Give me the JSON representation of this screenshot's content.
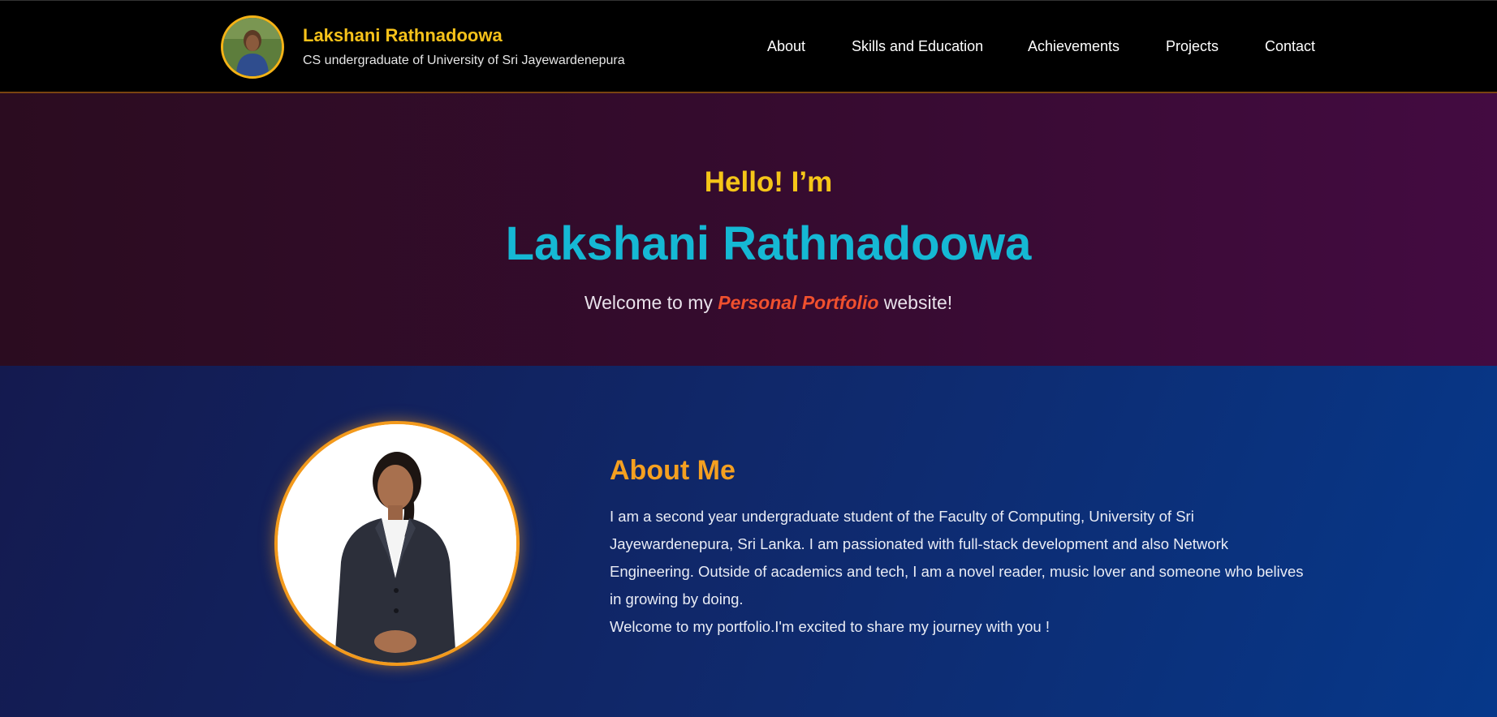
{
  "header": {
    "brand_name": "Lakshani Rathnadoowa",
    "brand_tagline": "CS undergraduate of University of Sri Jayewardenepura",
    "avatar_icon": "profile-photo",
    "nav": [
      {
        "label": "About"
      },
      {
        "label": "Skills and Education"
      },
      {
        "label": "Achievements"
      },
      {
        "label": "Projects"
      },
      {
        "label": "Contact"
      }
    ]
  },
  "hero": {
    "greeting": "Hello! I’m",
    "name": "Lakshani Rathnadoowa",
    "welcome_before": "Welcome to my",
    "welcome_highlight": "Personal Portfolio",
    "welcome_after": "website!"
  },
  "about": {
    "title": "About Me",
    "paragraph": "I am a second year undergraduate student of the Faculty of Computing, University of Sri Jayewardenepura, Sri Lanka. I am passionated with full-stack development and also Network Engineering. Outside of academics and tech, I am a novel reader, music lover and someone who belives in growing by doing.",
    "closing": "Welcome to my portfolio.I'm excited to share my journey with you !"
  },
  "colors": {
    "brand_accent": "#f7c21a",
    "hero_name": "#15b8d4",
    "highlight": "#f0502e",
    "about_title": "#f5a020"
  }
}
